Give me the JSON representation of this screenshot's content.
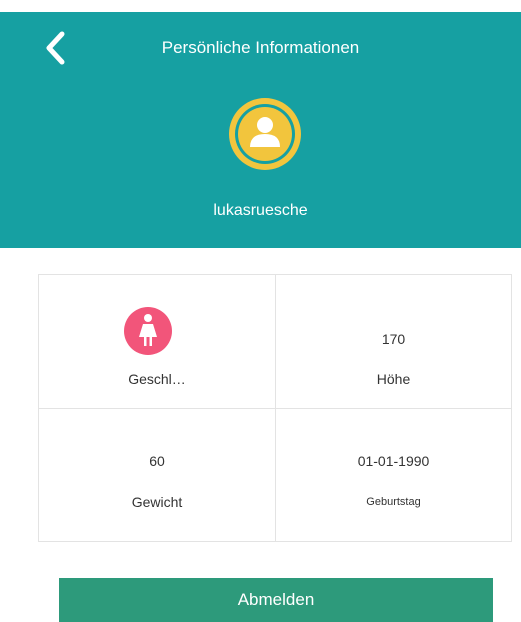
{
  "header": {
    "title": "Persönliche Informationen",
    "username": "lukasruesche",
    "background_color": "#16a0a2",
    "back_icon": "chevron-left-icon",
    "avatar_icon": "user-icon",
    "avatar_color": "#f2c53d"
  },
  "profile": {
    "gender": {
      "label": "Geschl…",
      "icon": "female-icon",
      "icon_color": "#f2557a"
    },
    "height": {
      "value": "170",
      "label": "Höhe"
    },
    "weight": {
      "value": "60",
      "label": "Gewicht"
    },
    "birthday": {
      "value": "01-01-1990",
      "label": "Geburtstag"
    }
  },
  "logout": {
    "label": "Abmelden",
    "color": "#2d9a7b"
  }
}
